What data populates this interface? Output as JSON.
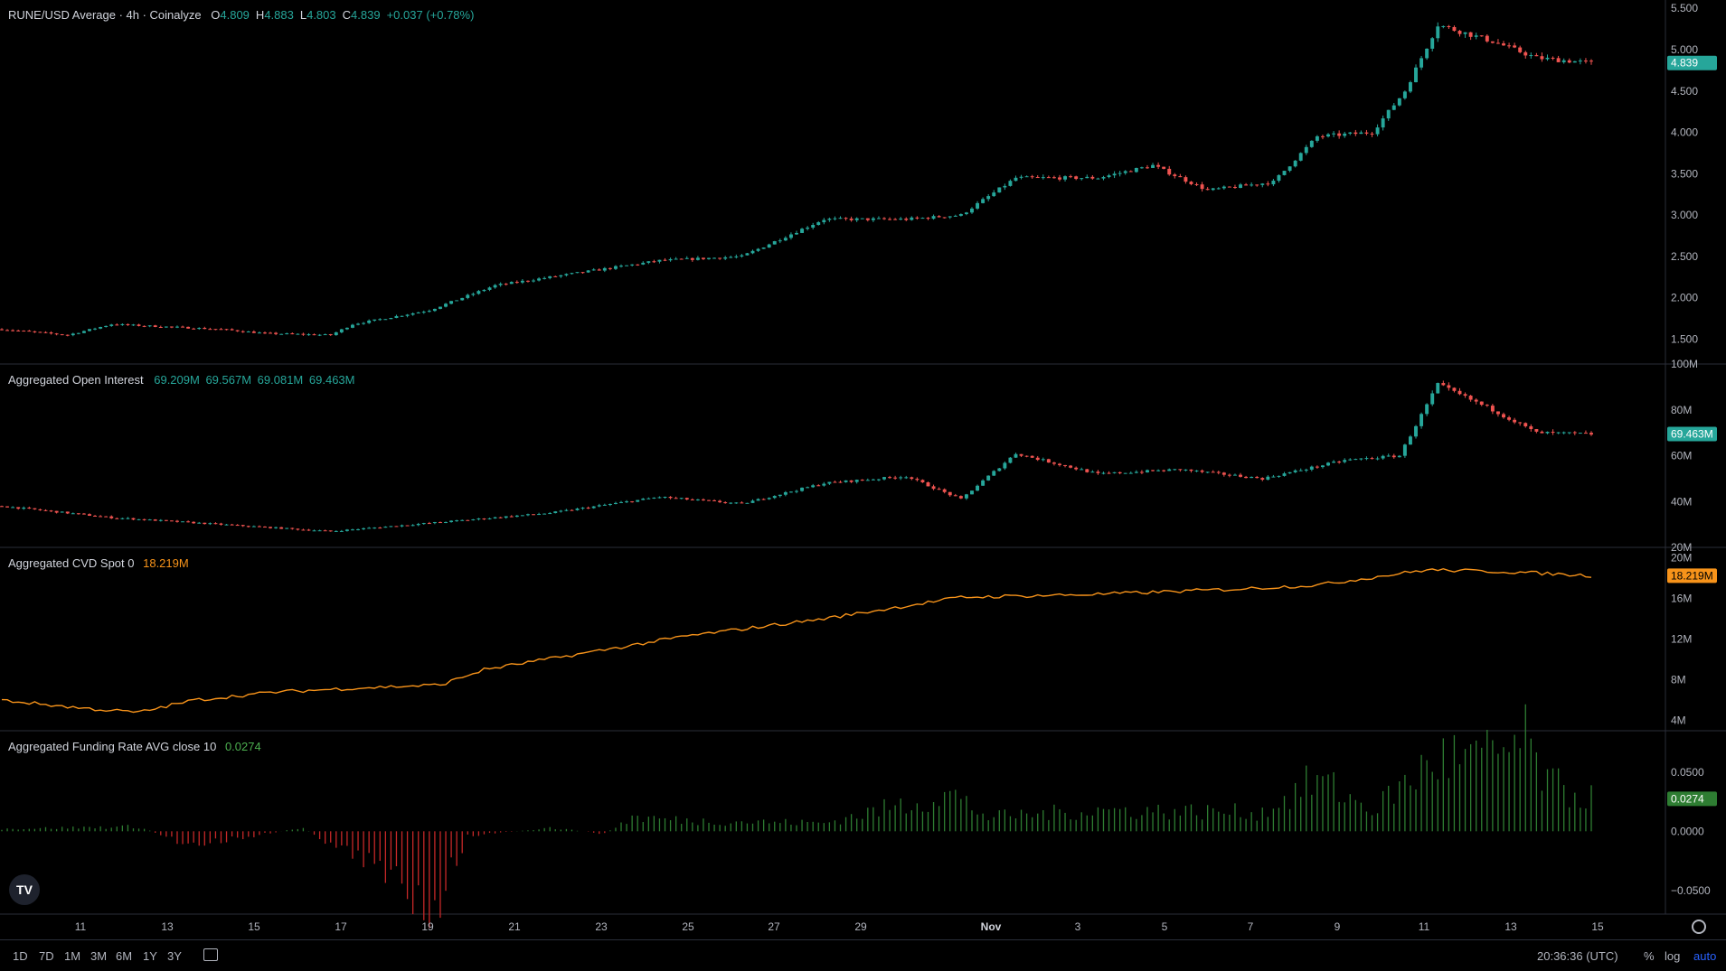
{
  "panes": {
    "price": {
      "title": "RUNE/USD Average · 4h · Coinalyze",
      "ohlc": [
        {
          "k": "O",
          "v": "4.809"
        },
        {
          "k": "H",
          "v": "4.883"
        },
        {
          "k": "L",
          "v": "4.803"
        },
        {
          "k": "C",
          "v": "4.839"
        },
        {
          "k": "",
          "v": "+0.037 (+0.78%)"
        }
      ],
      "last_label": "4.839",
      "axis_ticks": [
        "5.500",
        "5.000",
        "4.500",
        "4.000",
        "3.500",
        "3.000",
        "2.500",
        "2.000",
        "1.500"
      ]
    },
    "oi": {
      "title": "Aggregated Open Interest",
      "values": [
        "69.209M",
        "69.567M",
        "69.081M",
        "69.463M"
      ],
      "last_label": "69.463M",
      "axis_ticks": [
        "100M",
        "80M",
        "60M",
        "40M",
        "20M"
      ]
    },
    "cvd": {
      "title": "Aggregated CVD Spot 0",
      "value": "18.219M",
      "last_label": "18.219M",
      "axis_ticks": [
        "20M",
        "16M",
        "12M",
        "8M",
        "4M"
      ]
    },
    "funding": {
      "title": "Aggregated Funding Rate AVG close 10",
      "value": "0.0274",
      "last_label": "0.0274",
      "axis_ticks": [
        "0.0500",
        "0.0000",
        "−0.0500"
      ]
    }
  },
  "time_axis": [
    "11",
    "13",
    "15",
    "17",
    "19",
    "21",
    "23",
    "25",
    "27",
    "29",
    "Nov",
    "3",
    "5",
    "7",
    "9",
    "11",
    "13",
    "15"
  ],
  "timeframes": [
    "1D",
    "7D",
    "1M",
    "3M",
    "6M",
    "1Y",
    "3Y"
  ],
  "clock": "20:36:36 (UTC)",
  "scale_options": [
    "%",
    "log",
    "auto"
  ],
  "colors": {
    "up": "#26a69a",
    "down": "#ef5350",
    "cvd": "#f7931a",
    "funding_pos": "#2e7d32",
    "funding_neg": "#c62828",
    "accent": "#2962ff"
  },
  "chart_data": [
    {
      "type": "candlestick",
      "name": "RUNE/USD Average",
      "x_range": [
        "Oct 10",
        "Nov 14"
      ],
      "ylim": [
        1.2,
        5.6
      ],
      "close_keypoints": [
        [
          0,
          1.62
        ],
        [
          12,
          1.55
        ],
        [
          20,
          1.68
        ],
        [
          40,
          1.62
        ],
        [
          48,
          1.57
        ],
        [
          60,
          1.55
        ],
        [
          64,
          1.68
        ],
        [
          78,
          1.85
        ],
        [
          90,
          2.15
        ],
        [
          105,
          2.3
        ],
        [
          120,
          2.45
        ],
        [
          135,
          2.5
        ],
        [
          150,
          2.95
        ],
        [
          165,
          2.95
        ],
        [
          175,
          3.0
        ],
        [
          185,
          3.45
        ],
        [
          200,
          3.45
        ],
        [
          210,
          3.6
        ],
        [
          220,
          3.3
        ],
        [
          232,
          3.4
        ],
        [
          240,
          3.95
        ],
        [
          250,
          4.0
        ],
        [
          256,
          4.5
        ],
        [
          262,
          5.3
        ],
        [
          272,
          5.1
        ],
        [
          280,
          4.9
        ],
        [
          290,
          4.84
        ]
      ]
    },
    {
      "type": "candlestick",
      "name": "Aggregated Open Interest",
      "unit": "M",
      "ylim": [
        20,
        100
      ],
      "close_keypoints": [
        [
          0,
          38
        ],
        [
          20,
          33
        ],
        [
          40,
          30
        ],
        [
          60,
          27
        ],
        [
          80,
          31
        ],
        [
          100,
          35
        ],
        [
          120,
          42
        ],
        [
          135,
          39
        ],
        [
          150,
          48
        ],
        [
          165,
          51
        ],
        [
          175,
          41
        ],
        [
          185,
          61
        ],
        [
          200,
          52
        ],
        [
          215,
          54
        ],
        [
          230,
          50
        ],
        [
          245,
          58
        ],
        [
          255,
          60
        ],
        [
          262,
          91
        ],
        [
          272,
          80
        ],
        [
          280,
          70
        ],
        [
          290,
          69.46
        ]
      ]
    },
    {
      "type": "line",
      "name": "Aggregated CVD Spot",
      "unit": "M",
      "ylim": [
        3,
        21
      ],
      "keypoints": [
        [
          0,
          6
        ],
        [
          15,
          5.2
        ],
        [
          25,
          4.8
        ],
        [
          35,
          6
        ],
        [
          50,
          6.8
        ],
        [
          65,
          7.2
        ],
        [
          80,
          7.5
        ],
        [
          88,
          9
        ],
        [
          105,
          10.5
        ],
        [
          125,
          12.3
        ],
        [
          150,
          14
        ],
        [
          175,
          16.1
        ],
        [
          200,
          16.4
        ],
        [
          225,
          16.9
        ],
        [
          240,
          17.3
        ],
        [
          260,
          18.8
        ],
        [
          275,
          18.6
        ],
        [
          290,
          18.219
        ]
      ]
    },
    {
      "type": "bar",
      "name": "Aggregated Funding Rate AVG close 10",
      "ylim": [
        -0.07,
        0.085
      ],
      "keypoints": [
        [
          0,
          0.002
        ],
        [
          25,
          0.004
        ],
        [
          33,
          -0.01
        ],
        [
          40,
          -0.008
        ],
        [
          55,
          0.003
        ],
        [
          79,
          -0.06
        ],
        [
          85,
          -0.004
        ],
        [
          100,
          0.003
        ],
        [
          110,
          -0.002
        ],
        [
          115,
          0.012
        ],
        [
          125,
          0.009
        ],
        [
          150,
          0.007
        ],
        [
          173,
          0.032
        ],
        [
          180,
          0.012
        ],
        [
          200,
          0.018
        ],
        [
          230,
          0.016
        ],
        [
          240,
          0.044
        ],
        [
          250,
          0.018
        ],
        [
          262,
          0.062
        ],
        [
          270,
          0.06
        ],
        [
          278,
          0.075
        ],
        [
          282,
          0.04
        ],
        [
          290,
          0.0274
        ]
      ]
    }
  ]
}
